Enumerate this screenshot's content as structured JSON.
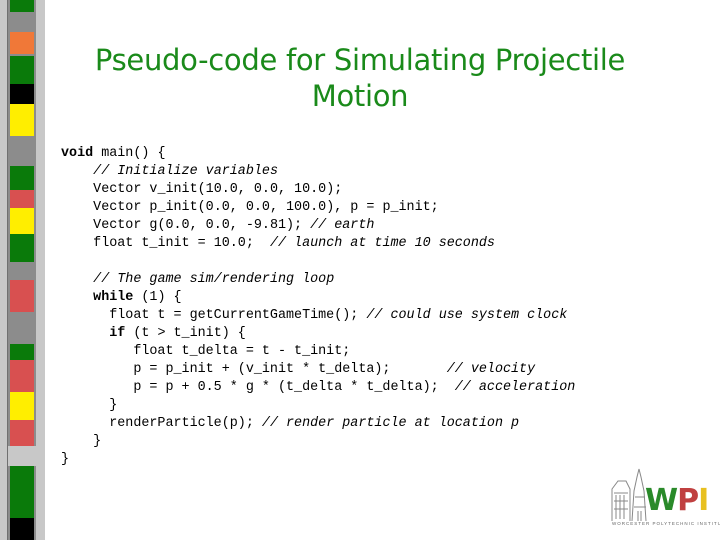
{
  "slide": {
    "title": "Pseudo-code for Simulating Projectile Motion",
    "accent_color": "#1a8a1a"
  },
  "sidebar": {
    "stripes": [
      {
        "color": "#0a7a0a"
      },
      {
        "color": "#f07838"
      },
      {
        "color": "#0a7a0a"
      },
      {
        "color": "#000000"
      },
      {
        "color": "#ffee00"
      },
      {
        "color": "#0a7a0a"
      },
      {
        "color": "#d85050"
      },
      {
        "color": "#ffee00"
      },
      {
        "color": "#0a7a0a"
      },
      {
        "color": "#d85050"
      },
      {
        "color": "#8c8c8c"
      },
      {
        "color": "#0a7a0a"
      },
      {
        "color": "#d85050"
      },
      {
        "color": "#ffee00"
      },
      {
        "color": "#d85050"
      },
      {
        "color": "#0a7a0a"
      },
      {
        "color": "#000000"
      }
    ]
  },
  "code": {
    "lines": [
      {
        "indent": 0,
        "parts": [
          {
            "t": "void",
            "s": "kw"
          },
          {
            "t": " main() {",
            "s": ""
          }
        ]
      },
      {
        "indent": 4,
        "parts": [
          {
            "t": "// Initialize variables",
            "s": "cm"
          }
        ]
      },
      {
        "indent": 4,
        "parts": [
          {
            "t": "Vector v_init(10.0, 0.0, 10.0);",
            "s": ""
          }
        ]
      },
      {
        "indent": 4,
        "parts": [
          {
            "t": "Vector p_init(0.0, 0.0, 100.0), p = p_init;",
            "s": ""
          }
        ]
      },
      {
        "indent": 4,
        "parts": [
          {
            "t": "Vector g(0.0, 0.0, -9.81); ",
            "s": ""
          },
          {
            "t": "// earth",
            "s": "cm"
          }
        ]
      },
      {
        "indent": 4,
        "parts": [
          {
            "t": "float t_init = 10.0;  ",
            "s": ""
          },
          {
            "t": "// launch at time 10 seconds",
            "s": "cm"
          }
        ]
      },
      {
        "indent": 0,
        "parts": []
      },
      {
        "indent": 4,
        "parts": [
          {
            "t": "// The game sim/rendering loop",
            "s": "cm"
          }
        ]
      },
      {
        "indent": 4,
        "parts": [
          {
            "t": "while",
            "s": "kw"
          },
          {
            "t": " (1) {",
            "s": ""
          }
        ]
      },
      {
        "indent": 6,
        "parts": [
          {
            "t": "float t = getCurrentGameTime(); ",
            "s": ""
          },
          {
            "t": "// could use system clock",
            "s": "cm"
          }
        ]
      },
      {
        "indent": 6,
        "parts": [
          {
            "t": "if",
            "s": "kw"
          },
          {
            "t": " (t > t_init) {",
            "s": ""
          }
        ]
      },
      {
        "indent": 9,
        "parts": [
          {
            "t": "float t_delta = t - t_init;",
            "s": ""
          }
        ]
      },
      {
        "indent": 9,
        "parts": [
          {
            "t": "p = p_init + (v_init * t_delta);       ",
            "s": ""
          },
          {
            "t": "// velocity",
            "s": "cm"
          }
        ]
      },
      {
        "indent": 9,
        "parts": [
          {
            "t": "p = p + 0.5 * g * (t_delta * t_delta);  ",
            "s": ""
          },
          {
            "t": "// acceleration",
            "s": "cm"
          }
        ]
      },
      {
        "indent": 6,
        "parts": [
          {
            "t": "}",
            "s": ""
          }
        ]
      },
      {
        "indent": 6,
        "parts": [
          {
            "t": "renderParticle(p); ",
            "s": ""
          },
          {
            "t": "// render particle at location p",
            "s": "cm"
          }
        ]
      },
      {
        "indent": 4,
        "parts": [
          {
            "t": "}",
            "s": ""
          }
        ]
      },
      {
        "indent": 0,
        "parts": [
          {
            "t": "}",
            "s": ""
          }
        ]
      }
    ]
  },
  "logo": {
    "letters": [
      "W",
      "P",
      "I"
    ],
    "tagline": "WORCESTER POLYTECHNIC INSTITUTE"
  }
}
